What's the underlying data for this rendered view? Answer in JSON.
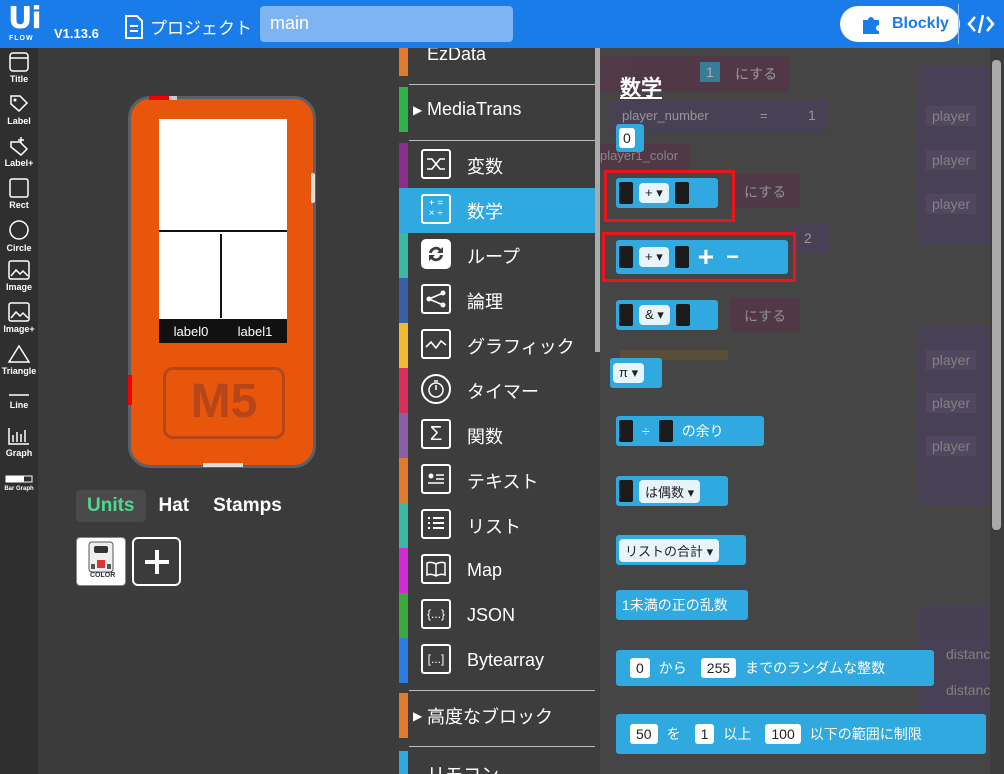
{
  "topbar": {
    "logo_text": "Ui",
    "logo_sub": "FLOW",
    "version": "V1.13.6",
    "project_label": "プロジェクト",
    "project_name": "main",
    "blockly_label": "Blockly"
  },
  "tools": [
    {
      "label": "Title",
      "icon": "title-icon"
    },
    {
      "label": "Label",
      "icon": "label-icon"
    },
    {
      "label": "Label+",
      "icon": "label-plus-icon"
    },
    {
      "label": "Rect",
      "icon": "rect-icon"
    },
    {
      "label": "Circle",
      "icon": "circle-icon"
    },
    {
      "label": "Image",
      "icon": "image-icon"
    },
    {
      "label": "Image+",
      "icon": "image-plus-icon"
    },
    {
      "label": "Triangle",
      "icon": "triangle-icon"
    },
    {
      "label": "Line",
      "icon": "line-icon"
    },
    {
      "label": "Graph",
      "icon": "graph-icon"
    },
    {
      "label": "Bar Graph",
      "icon": "bar-graph-icon"
    }
  ],
  "device": {
    "label0": "label0",
    "label1": "label1",
    "brand": "M5"
  },
  "device_tabs": {
    "units": "Units",
    "hat": "Hat",
    "stamps": "Stamps"
  },
  "unit_color_label": "COLOR",
  "categories": {
    "ezdata": "EzData",
    "mediatrans": "MediaTrans",
    "variables": "変数",
    "math": "数学",
    "loops": "ループ",
    "logic": "論理",
    "graphics": "グラフィック",
    "timer": "タイマー",
    "functions": "関数",
    "text": "テキスト",
    "lists": "リスト",
    "map": "Map",
    "json": "JSON",
    "bytearray": "Bytearray",
    "advanced": "高度なブロック",
    "remote": "リモコン"
  },
  "category_colors": {
    "ezdata": "#e07a2e",
    "mediatrans": "#2fb24a",
    "variables": "#8a2d8f",
    "math": "#2fa9e0",
    "loops": "#3ab8a4",
    "logic": "#3a5fa8",
    "graphics": "#f0b92e",
    "timer": "#d92e5a",
    "functions": "#8a5ea8",
    "text": "#e07a2e",
    "lists": "#3ab8a4",
    "map": "#d42ad6",
    "json": "#3aa83a",
    "bytearray": "#2a7ce0",
    "advanced": "#e07a2e",
    "remote": "#2fa9e0"
  },
  "flyout": {
    "title": "数学",
    "number_zero": "0",
    "op_plus": "+",
    "op_and": "&",
    "pi": "π",
    "op_div": "÷",
    "remainder": "の余り",
    "is_even": "は偶数",
    "list_sum": "リストの合計",
    "random_frac": "1未満の正の乱数",
    "rand_from": "0",
    "rand_kara": "から",
    "rand_to": "255",
    "rand_suffix": "までのランダムな整数",
    "clamp_val": "50",
    "clamp_wo": "を",
    "clamp_min": "1",
    "clamp_ijou": "以上",
    "clamp_max": "100",
    "clamp_suffix": "以下の範囲に制限",
    "plus_sign": "+",
    "minus_sign": "−"
  },
  "background_blocks": {
    "set_text": "にする",
    "num_one": "1",
    "num_two": "2",
    "var_player_number": "player_number",
    "var_player_color": "player1_color",
    "eq": "=",
    "r1": "player",
    "r2": "player",
    "r3": "player",
    "r4": "player",
    "r5": "player",
    "r6": "player",
    "d1": "distance",
    "d2": "distance"
  }
}
